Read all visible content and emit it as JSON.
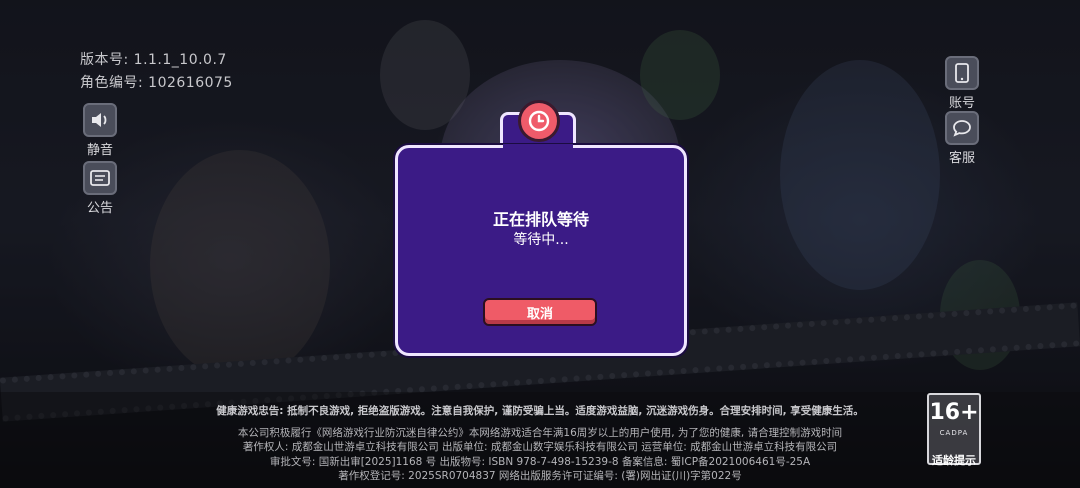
{
  "info": {
    "version": "版本号: 1.1.1_10.0.7",
    "role_id": "角色编号:  102616075"
  },
  "left_buttons": {
    "mute": "静音",
    "notice": "公告"
  },
  "right_buttons": {
    "account": "账号",
    "service": "客服"
  },
  "dialog": {
    "title": "正在排队等待",
    "status": "等待中...",
    "cancel": "取消",
    "icon": "clock-icon"
  },
  "footer": {
    "health": "健康游戏忠告: 抵制不良游戏, 拒绝盗版游戏。注意自我保护, 谨防受骗上当。适度游戏益脑, 沉迷游戏伤身。合理安排时间, 享受健康生活。",
    "line1": "本公司积极履行《网络游戏行业防沉迷自律公约》本网络游戏适合年满16周岁以上的用户使用, 为了您的健康, 请合理控制游戏时间",
    "line2": "著作权人: 成都金山世游卓立科技有限公司 出版单位: 成都金山数字娱乐科技有限公司 运营单位: 成都金山世游卓立科技有限公司",
    "line3": "审批文号: 国新出审[2025]1168 号 出版物号: ISBN 978-7-498-15239-8 备案信息: 蜀ICP备2021006461号-25A",
    "line4": "著作权登记号: 2025SR0704837 网络出版服务许可证编号: (署)网出证(川)字第022号"
  },
  "age_rating": {
    "age": "16+",
    "org": "CADPA",
    "tip": "适龄提示"
  },
  "colors": {
    "dialog_bg": "#3b1b86",
    "dialog_border": "#efe6ff",
    "button_red": "#ef5b67"
  }
}
